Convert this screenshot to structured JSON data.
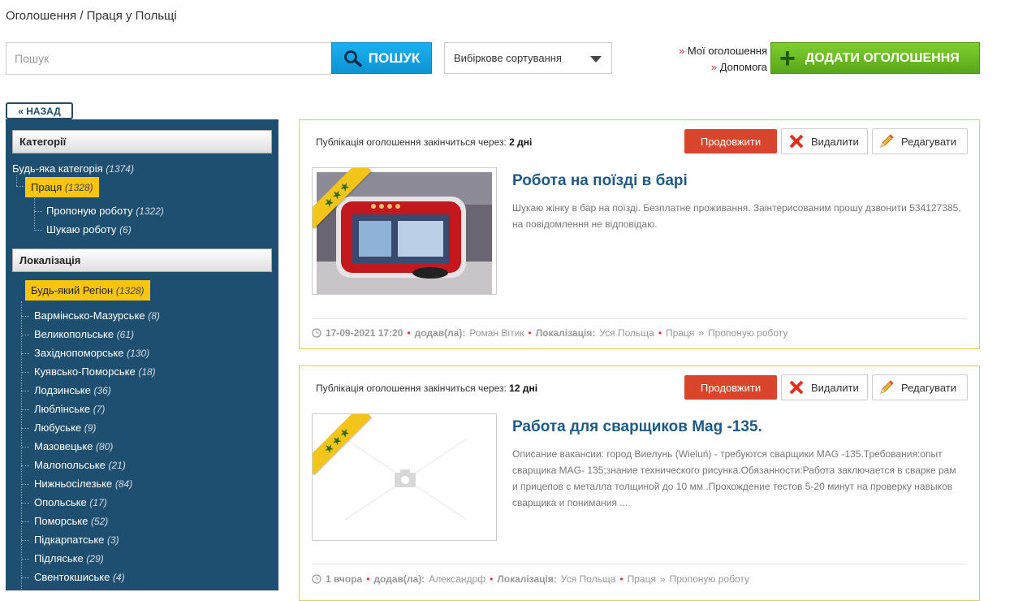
{
  "breadcrumb": "Оголошення / Праця у Польщі",
  "search": {
    "placeholder": "Пошук",
    "button": "ПОШУК"
  },
  "sort": {
    "selected": "Вибіркове сортування"
  },
  "links": {
    "my_ads": "Мої оголошення",
    "help": "Допомога",
    "arrow": "»"
  },
  "add_button": "ДОДАТИ ОГОЛОШЕННЯ",
  "back_button": "« НАЗАД",
  "sidebar": {
    "categories_title": "Категорії",
    "any_category": {
      "label": "Будь-яка категорія",
      "count": "(1374)"
    },
    "work": {
      "label": "Праця",
      "count": "(1328)"
    },
    "offer": {
      "label": "Пропоную роботу",
      "count": "(1322)"
    },
    "seek": {
      "label": "Шукаю роботу",
      "count": "(6)"
    },
    "location_title": "Локалізація",
    "any_region": {
      "label": "Будь-який Регіон",
      "count": "(1328)"
    },
    "regions": [
      {
        "label": "Вармінсько-Мазурське",
        "count": "(8)"
      },
      {
        "label": "Великопольське",
        "count": "(61)"
      },
      {
        "label": "Західнопоморське",
        "count": "(130)"
      },
      {
        "label": "Куявсько-Поморське",
        "count": "(18)"
      },
      {
        "label": "Лодзинське",
        "count": "(36)"
      },
      {
        "label": "Люблінське",
        "count": "(7)"
      },
      {
        "label": "Любуське",
        "count": "(9)"
      },
      {
        "label": "Мазовецьке",
        "count": "(80)"
      },
      {
        "label": "Малопольське",
        "count": "(21)"
      },
      {
        "label": "Нижньосілезьке",
        "count": "(84)"
      },
      {
        "label": "Опольське",
        "count": "(17)"
      },
      {
        "label": "Поморське",
        "count": "(52)"
      },
      {
        "label": "Підкарпатське",
        "count": "(3)"
      },
      {
        "label": "Підляське",
        "count": "(29)"
      },
      {
        "label": "Свентокшиське",
        "count": "(4)"
      }
    ]
  },
  "card_labels": {
    "expires": "Публікація оголошення закінчиться через:",
    "extend": "Продовжити",
    "delete": "Видалити",
    "edit": "Редагувати",
    "added_by": "додав(ла):",
    "location": "Локалізація:",
    "stars": "★★★",
    "breadcrumb_sep": "»"
  },
  "ads": [
    {
      "expires_in": "2 дні",
      "title": "Робота на поїзді в барі",
      "description": "Шукаю жінку в бар на поїзді. Безплатне проживання. Заінтерисованим прошу дзвонити 534127385, на повідомлення не відповідаю.",
      "date": "17-09-2021 17:20",
      "author": "Роман Вітик",
      "location": "Уся Польща",
      "category": "Праця",
      "subcategory": "Пропоную роботу"
    },
    {
      "expires_in": "12 дні",
      "title": "Работа для сварщиков Mag -135.",
      "description": "Описание вакансии: город Виелунь (Wieluń) - требуются сварщики MAG -135.Требования:опыт сварщика MAG- 135;знание технического рисунка.Обязанности:Работа заключается в сварке рам и прицепов с металла толщиной до 10 мм .Прохождение тестов 5-20 минут на проверку навыков сварщика и понимания ...",
      "date": "1 вчора",
      "author": "Александрф",
      "location": "Уся Польща",
      "category": "Праця",
      "subcategory": "Пропоную роботу"
    }
  ],
  "colors": {
    "sidebar": "#1f4f70",
    "highlight": "#f8c513",
    "extend": "#d9442c",
    "add": "#58a618",
    "search": "#0d94d4"
  }
}
